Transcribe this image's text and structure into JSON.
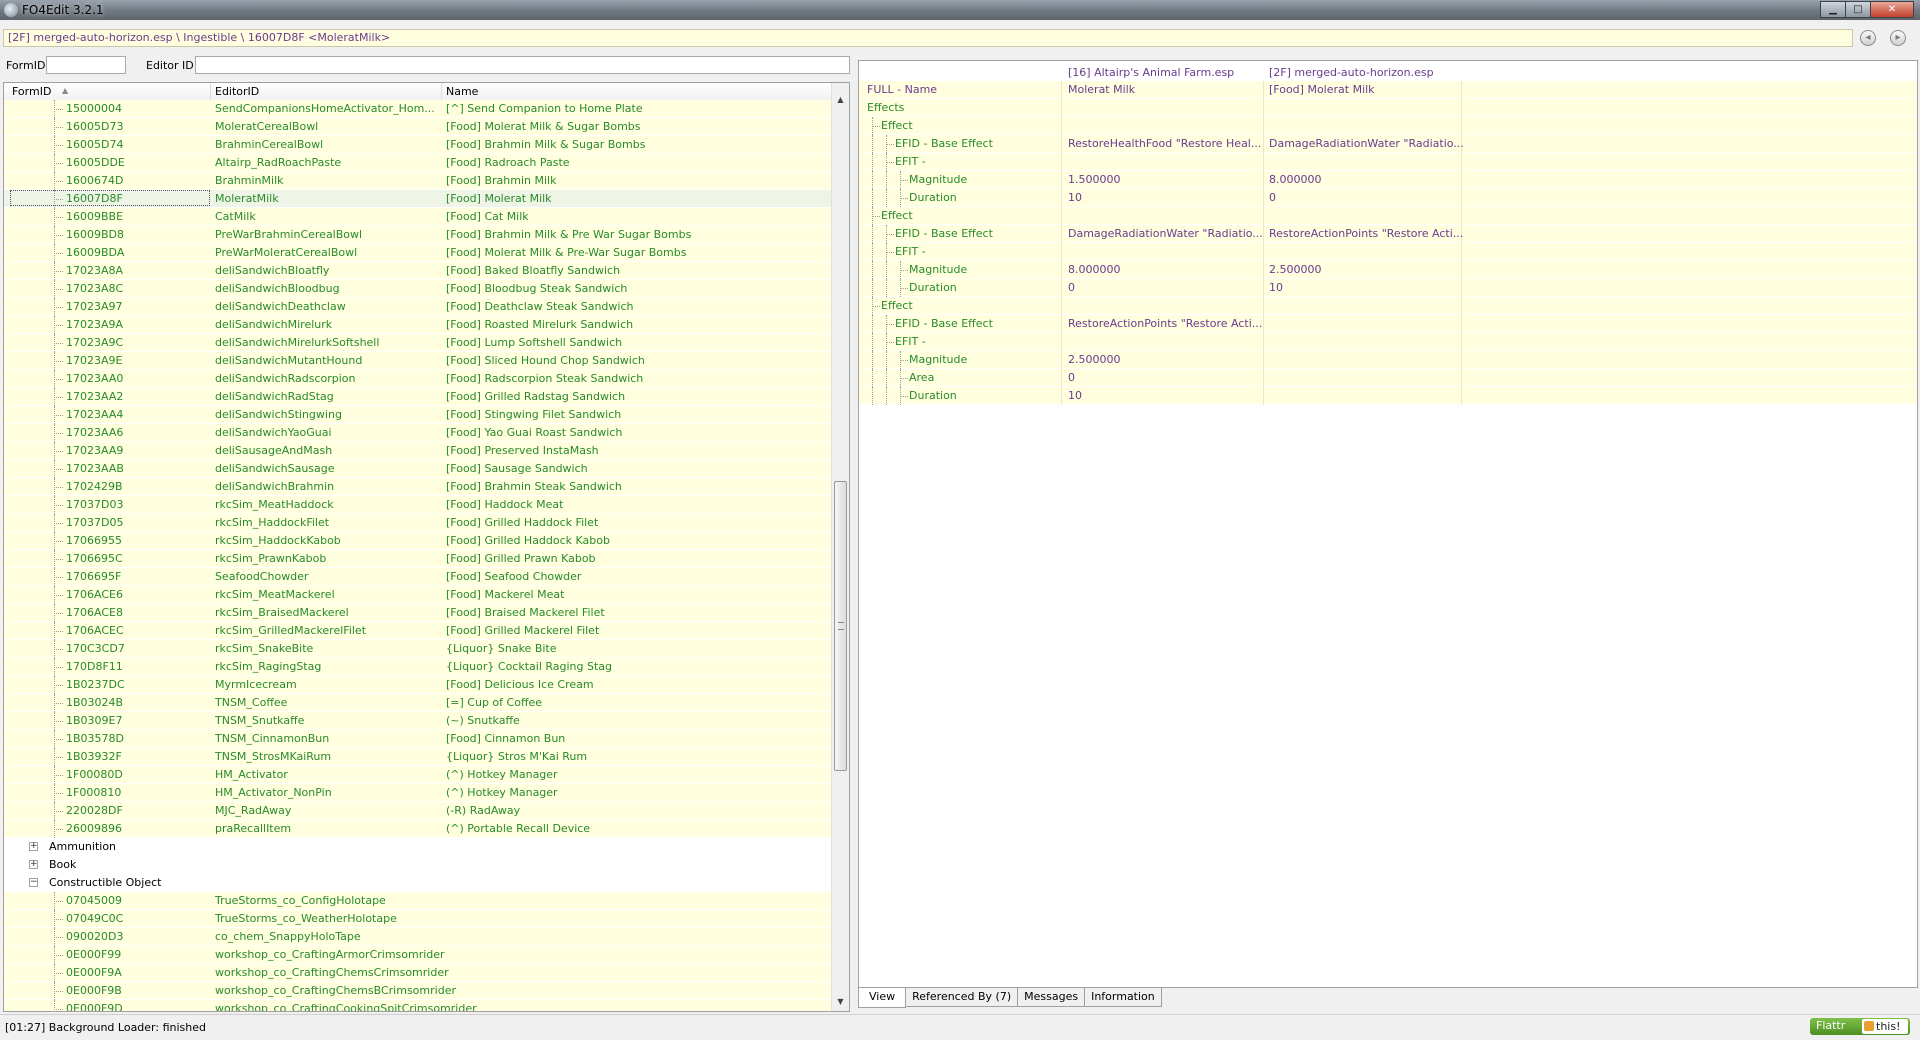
{
  "window": {
    "title": "FO4Edit 3.2.1",
    "minimize": "▁",
    "maximize": "□",
    "close": "✕"
  },
  "path": {
    "text": "[2F] merged-auto-horizon.esp \\ Ingestible \\ 16007D8F <MoleratMilk>",
    "back": "◂",
    "forward": "▸"
  },
  "filter": {
    "formid_label": "FormID",
    "formid_value": "",
    "editorid_label": "Editor ID",
    "editorid_value": ""
  },
  "left_columns": {
    "formid": "FormID",
    "editorid": "EditorID",
    "name": "Name",
    "sort_icon": "▲"
  },
  "left_rows": [
    {
      "type": "rec",
      "formid": "15000004",
      "editorid": "SendCompanionsHomeActivator_Hom...",
      "name": "[^] Send Companion to Home Plate"
    },
    {
      "type": "rec",
      "formid": "16005D73",
      "editorid": "MoleratCerealBowl",
      "name": "[Food] Molerat Milk & Sugar Bombs"
    },
    {
      "type": "rec",
      "formid": "16005D74",
      "editorid": "BrahminCerealBowl",
      "name": "[Food] Brahmin Milk & Sugar Bombs"
    },
    {
      "type": "rec",
      "formid": "16005DDE",
      "editorid": "Altairp_RadRoachPaste",
      "name": "[Food] Radroach Paste"
    },
    {
      "type": "rec",
      "formid": "1600674D",
      "editorid": "BrahminMilk",
      "name": "[Food] Brahmin Milk"
    },
    {
      "type": "rec",
      "formid": "16007D8F",
      "editorid": "MoleratMilk",
      "name": "[Food] Molerat Milk",
      "selected": true
    },
    {
      "type": "rec",
      "formid": "16009BBE",
      "editorid": "CatMilk",
      "name": "[Food] Cat Milk"
    },
    {
      "type": "rec",
      "formid": "16009BD8",
      "editorid": "PreWarBrahminCerealBowl",
      "name": "[Food] Brahmin Milk & Pre War Sugar Bombs"
    },
    {
      "type": "rec",
      "formid": "16009BDA",
      "editorid": "PreWarMoleratCerealBowl",
      "name": "[Food] Molerat Milk & Pre-War Sugar Bombs"
    },
    {
      "type": "rec",
      "formid": "17023A8A",
      "editorid": "deliSandwichBloatfly",
      "name": "[Food] Baked Bloatfly Sandwich"
    },
    {
      "type": "rec",
      "formid": "17023A8C",
      "editorid": "deliSandwichBloodbug",
      "name": "[Food] Bloodbug Steak Sandwich"
    },
    {
      "type": "rec",
      "formid": "17023A97",
      "editorid": "deliSandwichDeathclaw",
      "name": "[Food] Deathclaw Steak Sandwich"
    },
    {
      "type": "rec",
      "formid": "17023A9A",
      "editorid": "deliSandwichMirelurk",
      "name": "[Food] Roasted Mirelurk Sandwich"
    },
    {
      "type": "rec",
      "formid": "17023A9C",
      "editorid": "deliSandwichMirelurkSoftshell",
      "name": "[Food] Lump Softshell Sandwich"
    },
    {
      "type": "rec",
      "formid": "17023A9E",
      "editorid": "deliSandwichMutantHound",
      "name": "[Food] Sliced Hound Chop Sandwich"
    },
    {
      "type": "rec",
      "formid": "17023AA0",
      "editorid": "deliSandwichRadscorpion",
      "name": "[Food] Radscorpion Steak Sandwich"
    },
    {
      "type": "rec",
      "formid": "17023AA2",
      "editorid": "deliSandwichRadStag",
      "name": "[Food] Grilled Radstag Sandwich"
    },
    {
      "type": "rec",
      "formid": "17023AA4",
      "editorid": "deliSandwichStingwing",
      "name": "[Food] Stingwing Filet Sandwich"
    },
    {
      "type": "rec",
      "formid": "17023AA6",
      "editorid": "deliSandwichYaoGuai",
      "name": "[Food] Yao Guai Roast Sandwich"
    },
    {
      "type": "rec",
      "formid": "17023AA9",
      "editorid": "deliSausageAndMash",
      "name": "[Food] Preserved InstaMash"
    },
    {
      "type": "rec",
      "formid": "17023AAB",
      "editorid": "deliSandwichSausage",
      "name": "[Food] Sausage Sandwich"
    },
    {
      "type": "rec",
      "formid": "1702429B",
      "editorid": "deliSandwichBrahmin",
      "name": "[Food] Brahmin Steak Sandwich"
    },
    {
      "type": "rec",
      "formid": "17037D03",
      "editorid": "rkcSim_MeatHaddock",
      "name": "[Food] Haddock Meat"
    },
    {
      "type": "rec",
      "formid": "17037D05",
      "editorid": "rkcSim_HaddockFilet",
      "name": "[Food] Grilled Haddock Filet"
    },
    {
      "type": "rec",
      "formid": "17066955",
      "editorid": "rkcSim_HaddockKabob",
      "name": "[Food] Grilled Haddock Kabob"
    },
    {
      "type": "rec",
      "formid": "1706695C",
      "editorid": "rkcSim_PrawnKabob",
      "name": "[Food] Grilled Prawn Kabob"
    },
    {
      "type": "rec",
      "formid": "1706695F",
      "editorid": "SeafoodChowder",
      "name": "[Food] Seafood Chowder"
    },
    {
      "type": "rec",
      "formid": "1706ACE6",
      "editorid": "rkcSim_MeatMackerel",
      "name": "[Food] Mackerel Meat"
    },
    {
      "type": "rec",
      "formid": "1706ACE8",
      "editorid": "rkcSim_BraisedMackerel",
      "name": "[Food] Braised Mackerel Filet"
    },
    {
      "type": "rec",
      "formid": "1706ACEC",
      "editorid": "rkcSim_GrilledMackerelFilet",
      "name": "[Food] Grilled Mackerel Filet"
    },
    {
      "type": "rec",
      "formid": "170C3CD7",
      "editorid": "rkcSim_SnakeBite",
      "name": "{Liquor} Snake Bite"
    },
    {
      "type": "rec",
      "formid": "170D8F11",
      "editorid": "rkcSim_RagingStag",
      "name": "{Liquor} Cocktail Raging Stag"
    },
    {
      "type": "rec",
      "formid": "1B0237DC",
      "editorid": "MyrmIcecream",
      "name": "[Food] Delicious Ice Cream"
    },
    {
      "type": "rec",
      "formid": "1B03024B",
      "editorid": "TNSM_Coffee",
      "name": "[=] Cup of Coffee"
    },
    {
      "type": "rec",
      "formid": "1B0309E7",
      "editorid": "TNSM_Snutkaffe",
      "name": "(~) Snutkaffe"
    },
    {
      "type": "rec",
      "formid": "1B03578D",
      "editorid": "TNSM_CinnamonBun",
      "name": "[Food] Cinnamon Bun"
    },
    {
      "type": "rec",
      "formid": "1B03932F",
      "editorid": "TNSM_StrosMKaiRum",
      "name": "{Liquor} Stros M'Kai Rum"
    },
    {
      "type": "rec",
      "formid": "1F00080D",
      "editorid": "HM_Activator",
      "name": "(^) Hotkey Manager"
    },
    {
      "type": "rec",
      "formid": "1F000810",
      "editorid": "HM_Activator_NonPin",
      "name": "(^) Hotkey Manager"
    },
    {
      "type": "rec",
      "formid": "220028DF",
      "editorid": "MJC_RadAway",
      "name": "(-R) RadAway"
    },
    {
      "type": "rec",
      "formid": "26009896",
      "editorid": "praRecallItem",
      "name": "(^) Portable Recall Device"
    },
    {
      "type": "cat",
      "label": "Ammunition",
      "expander": "+"
    },
    {
      "type": "cat",
      "label": "Book",
      "expander": "+"
    },
    {
      "type": "cat",
      "label": "Constructible Object",
      "expander": "−"
    },
    {
      "type": "rec",
      "formid": "07045009",
      "editorid": "TrueStorms_co_ConfigHolotape",
      "name": ""
    },
    {
      "type": "rec",
      "formid": "07049C0C",
      "editorid": "TrueStorms_co_WeatherHolotape",
      "name": ""
    },
    {
      "type": "rec",
      "formid": "090020D3",
      "editorid": "co_chem_SnappyHoloTape",
      "name": ""
    },
    {
      "type": "rec",
      "formid": "0E000F99",
      "editorid": "workshop_co_CraftingArmorCrimsomrider",
      "name": ""
    },
    {
      "type": "rec",
      "formid": "0E000F9A",
      "editorid": "workshop_co_CraftingChemsCrimsomrider",
      "name": ""
    },
    {
      "type": "rec",
      "formid": "0E000F9B",
      "editorid": "workshop_co_CraftingChemsBCrimsomrider",
      "name": ""
    },
    {
      "type": "rec",
      "formid": "0E000F9D",
      "editorid": "workshop_co_CraftingCookingSpitCrimsomrider",
      "name": ""
    }
  ],
  "right_header": {
    "col1": "[16] Altairp's Animal Farm.esp",
    "col2": "[2F] merged-auto-horizon.esp"
  },
  "right_rows": [
    {
      "label": "FULL - Name",
      "indent": 0,
      "v1": "Molerat Milk",
      "v2": "[Food] Molerat Milk",
      "kind": "fullname"
    },
    {
      "label": "Effects",
      "indent": 0,
      "v1": "",
      "v2": ""
    },
    {
      "label": "Effect",
      "indent": 1,
      "v1": "",
      "v2": ""
    },
    {
      "label": "EFID - Base Effect",
      "indent": 2,
      "v1": "RestoreHealthFood \"Restore Heal...",
      "v2": "DamageRadiationWater \"Radiatio..."
    },
    {
      "label": "EFIT -",
      "indent": 2,
      "v1": "",
      "v2": ""
    },
    {
      "label": "Magnitude",
      "indent": 3,
      "v1": "1.500000",
      "v2": "8.000000"
    },
    {
      "label": "Duration",
      "indent": 3,
      "v1": "10",
      "v2": "0"
    },
    {
      "label": "Effect",
      "indent": 1,
      "v1": "",
      "v2": ""
    },
    {
      "label": "EFID - Base Effect",
      "indent": 2,
      "v1": "DamageRadiationWater \"Radiatio...",
      "v2": "RestoreActionPoints \"Restore Acti..."
    },
    {
      "label": "EFIT -",
      "indent": 2,
      "v1": "",
      "v2": ""
    },
    {
      "label": "Magnitude",
      "indent": 3,
      "v1": "8.000000",
      "v2": "2.500000"
    },
    {
      "label": "Duration",
      "indent": 3,
      "v1": "0",
      "v2": "10"
    },
    {
      "label": "Effect",
      "indent": 1,
      "v1": "",
      "v2": ""
    },
    {
      "label": "EFID - Base Effect",
      "indent": 2,
      "v1": "RestoreActionPoints \"Restore Acti...",
      "v2": ""
    },
    {
      "label": "EFIT -",
      "indent": 2,
      "v1": "",
      "v2": ""
    },
    {
      "label": "Magnitude",
      "indent": 3,
      "v1": "2.500000",
      "v2": ""
    },
    {
      "label": "Area",
      "indent": 3,
      "v1": "0",
      "v2": ""
    },
    {
      "label": "Duration",
      "indent": 3,
      "v1": "10",
      "v2": ""
    }
  ],
  "tabs": [
    "View",
    "Referenced By (7)",
    "Messages",
    "Information"
  ],
  "status": {
    "text": "[01:27] Background Loader: finished",
    "flattr_left": "Flattr",
    "flattr_right": "this!"
  },
  "colors": {
    "record_text": "#2a8a2a",
    "override_text": "#6a3b8e",
    "row_bg": "#ffffdf"
  }
}
